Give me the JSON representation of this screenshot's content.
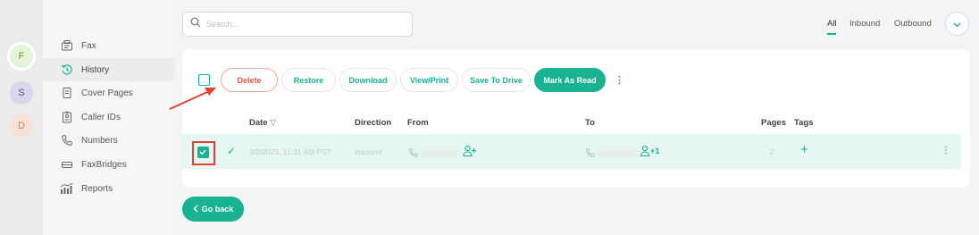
{
  "accounts": [
    {
      "initial": "F",
      "color": "#e4f3d9"
    },
    {
      "initial": "S",
      "color": "#d9d5ea"
    },
    {
      "initial": "D",
      "color": "#f8e2d6"
    }
  ],
  "sidebar": {
    "items": [
      {
        "label": "Fax",
        "icon": "fax-icon"
      },
      {
        "label": "History",
        "icon": "history-icon",
        "active": true
      },
      {
        "label": "Cover Pages",
        "icon": "document-icon"
      },
      {
        "label": "Caller IDs",
        "icon": "id-badge-icon"
      },
      {
        "label": "Numbers",
        "icon": "phone-icon"
      },
      {
        "label": "FaxBridges",
        "icon": "bridge-icon"
      },
      {
        "label": "Reports",
        "icon": "chart-icon"
      }
    ]
  },
  "search": {
    "placeholder": "Search..."
  },
  "filters": {
    "all": "All",
    "inbound": "Inbound",
    "outbound": "Outbound",
    "active": "All"
  },
  "toolbar": {
    "delete": "Delete",
    "restore": "Restore",
    "download": "Download",
    "view_print": "View/Print",
    "save_to_drive": "Save To Drive",
    "mark_as_read": "Mark As Read",
    "more": "⋮"
  },
  "table": {
    "headers": {
      "date": "Date",
      "direction": "Direction",
      "from": "From",
      "to": "To",
      "pages": "Pages",
      "tags": "Tags"
    },
    "sort_indicator": "▽",
    "rows": [
      {
        "checked": true,
        "status": "✓",
        "date": "3/2/2023, 11:31 AM PST",
        "direction": "inbound",
        "to_extra": "+1",
        "pages": "2",
        "add_tag": "+",
        "menu": "⋮"
      }
    ]
  },
  "footer": {
    "go_back": "Go back"
  },
  "colors": {
    "accent": "#19b394",
    "danger": "#e3584a",
    "annotation": "#e04232"
  }
}
